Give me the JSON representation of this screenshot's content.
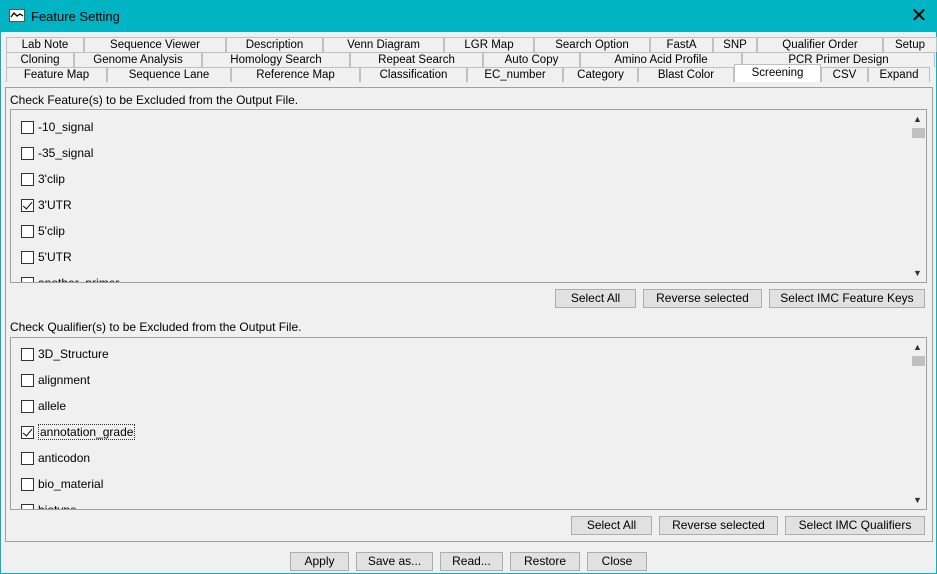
{
  "window": {
    "title": "Feature Setting",
    "close_glyph": "✕"
  },
  "tabs": {
    "row1": [
      "Lab Note",
      "Sequence Viewer",
      "Description",
      "Venn Diagram",
      "LGR Map",
      "Search Option",
      "FastA",
      "SNP",
      "Qualifier Order",
      "Setup"
    ],
    "row2": [
      "Cloning",
      "Genome Analysis",
      "Homology Search",
      "Repeat Search",
      "Auto Copy",
      "Amino Acid Profile",
      "PCR Primer Design"
    ],
    "row3": [
      "Feature Map",
      "Sequence Lane",
      "Reference Map",
      "Classification",
      "EC_number",
      "Category",
      "Blast Color",
      "Screening",
      "CSV",
      "Expand"
    ],
    "active": "Screening"
  },
  "features": {
    "label": "Check Feature(s) to be Excluded from the Output File.",
    "items": [
      {
        "label": "-10_signal",
        "checked": false
      },
      {
        "label": "-35_signal",
        "checked": false
      },
      {
        "label": "3'clip",
        "checked": false
      },
      {
        "label": "3'UTR",
        "checked": true
      },
      {
        "label": "5'clip",
        "checked": false
      },
      {
        "label": "5'UTR",
        "checked": false
      },
      {
        "label": "another_primer",
        "checked": false
      }
    ],
    "buttons": {
      "select_all": "Select All",
      "reverse": "Reverse selected",
      "select_imc": "Select IMC Feature Keys"
    }
  },
  "qualifiers": {
    "label": "Check Qualifier(s) to be Excluded from the Output File.",
    "items": [
      {
        "label": "3D_Structure",
        "checked": false
      },
      {
        "label": "alignment",
        "checked": false
      },
      {
        "label": "allele",
        "checked": false
      },
      {
        "label": "annotation_grade",
        "checked": true
      },
      {
        "label": "anticodon",
        "checked": false
      },
      {
        "label": "bio_material",
        "checked": false
      },
      {
        "label": "biotype",
        "checked": false
      }
    ],
    "buttons": {
      "select_all": "Select All",
      "reverse": "Reverse selected",
      "select_imc": "Select IMC Qualifiers"
    }
  },
  "footer": {
    "apply": "Apply",
    "save_as": "Save as...",
    "read": "Read...",
    "restore": "Restore",
    "close": "Close"
  },
  "scroll": {
    "up_glyph": "▲",
    "down_glyph": "▼"
  }
}
